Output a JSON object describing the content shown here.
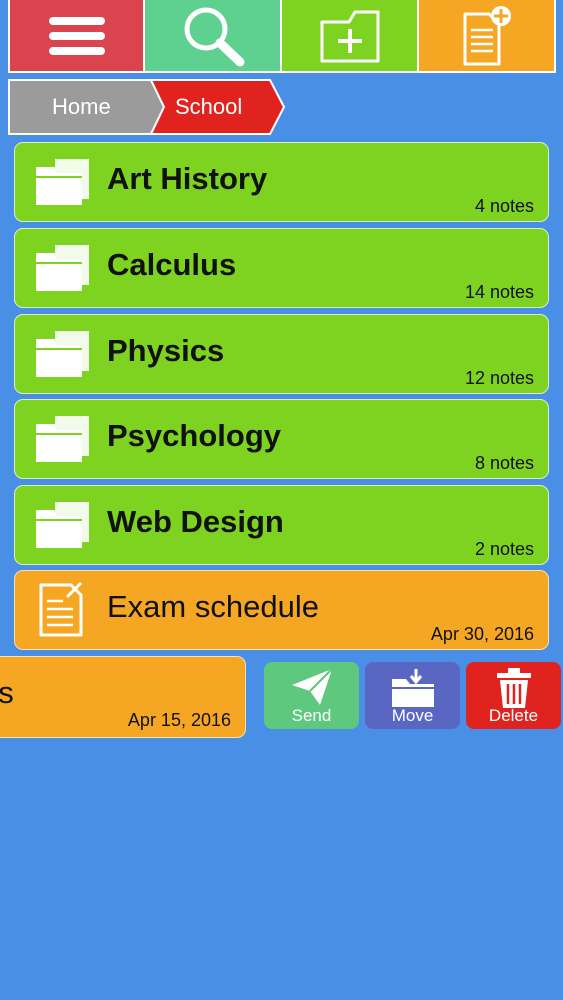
{
  "toolbar": {
    "buttons": [
      {
        "icon": "menu-icon",
        "color": "#d9444e"
      },
      {
        "icon": "search-icon",
        "color": "#5ed08f"
      },
      {
        "icon": "new-folder-icon",
        "color": "#7ed321"
      },
      {
        "icon": "new-note-icon",
        "color": "#f5a623"
      }
    ]
  },
  "breadcrumb": {
    "home": "Home",
    "current": "School"
  },
  "folders": [
    {
      "name": "Art History",
      "count": "4 notes"
    },
    {
      "name": "Calculus",
      "count": "14 notes"
    },
    {
      "name": "Physics",
      "count": "12 notes"
    },
    {
      "name": "Psychology",
      "count": "8 notes"
    },
    {
      "name": "Web Design",
      "count": "2 notes"
    }
  ],
  "notes": [
    {
      "name": "Exam schedule",
      "date": "Apr 30, 2016"
    }
  ],
  "swiped_note": {
    "name_fragment": "as",
    "date": "Apr 15, 2016"
  },
  "actions": {
    "send": "Send",
    "move": "Move",
    "delete": "Delete"
  },
  "colors": {
    "background": "#4a8fe6",
    "folder": "#7ed321",
    "note": "#f5a623",
    "send": "#5ec87e",
    "move": "#5a67c2",
    "delete": "#e0231f",
    "breadcrumb_home": "#9b9b9b",
    "breadcrumb_current": "#e0231f"
  }
}
